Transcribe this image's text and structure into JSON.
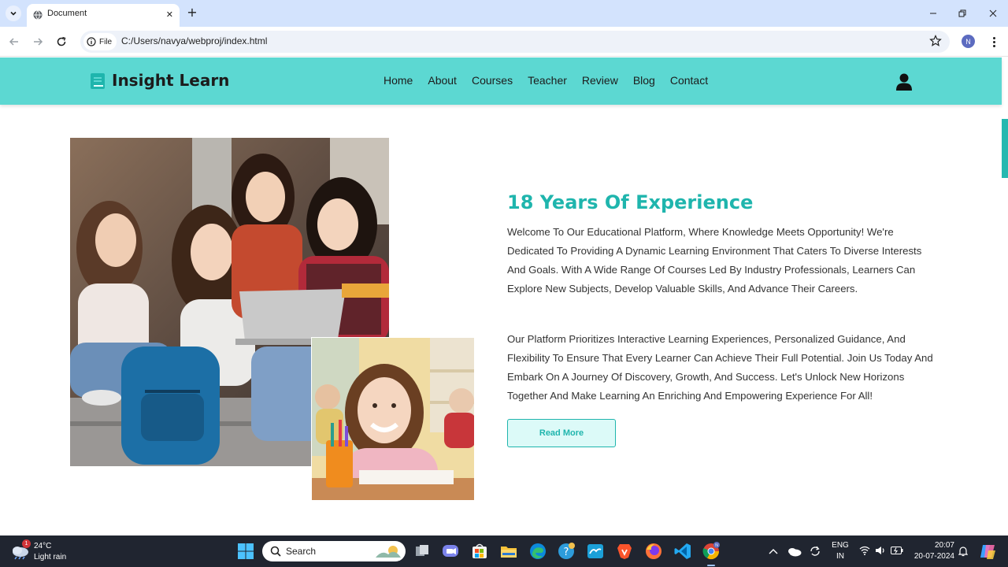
{
  "browser": {
    "tab_title": "Document",
    "close_tab_glyph": "✕",
    "new_tab_glyph": "+",
    "security_chip_label": "File",
    "url": "C:/Users/navya/webproj/index.html",
    "profile_initial": "N"
  },
  "site": {
    "brand": "Insight Learn",
    "nav": [
      "Home",
      "About",
      "Courses",
      "Teacher",
      "Review",
      "Blog",
      "Contact"
    ],
    "accent_color": "#5cd8d2",
    "title_color": "#1fb5ad"
  },
  "about": {
    "title": "18 Years Of Experience",
    "paragraph1": "Welcome To Our Educational Platform, Where Knowledge Meets Opportunity! We're Dedicated To Providing A Dynamic Learning Environment That Caters To Diverse Interests And Goals. With A Wide Range Of Courses Led By Industry Professionals, Learners Can Explore New Subjects, Develop Valuable Skills, And Advance Their Careers.",
    "paragraph2": "Our Platform Prioritizes Interactive Learning Experiences, Personalized Guidance, And Flexibility To Ensure That Every Learner Can Achieve Their Full Potential. Join Us Today And Embark On A Journey Of Discovery, Growth, And Success. Let's Unlock New Horizons Together And Make Learning An Enriching And Empowering Experience For All!",
    "button": "Read More"
  },
  "taskbar": {
    "weather_temp": "24°C",
    "weather_condition": "Light rain",
    "weather_badge": "1",
    "search_label": "Search",
    "lang_top": "ENG",
    "lang_bottom": "IN",
    "time": "20:07",
    "date": "20-07-2024",
    "chrome_badge": "N"
  }
}
